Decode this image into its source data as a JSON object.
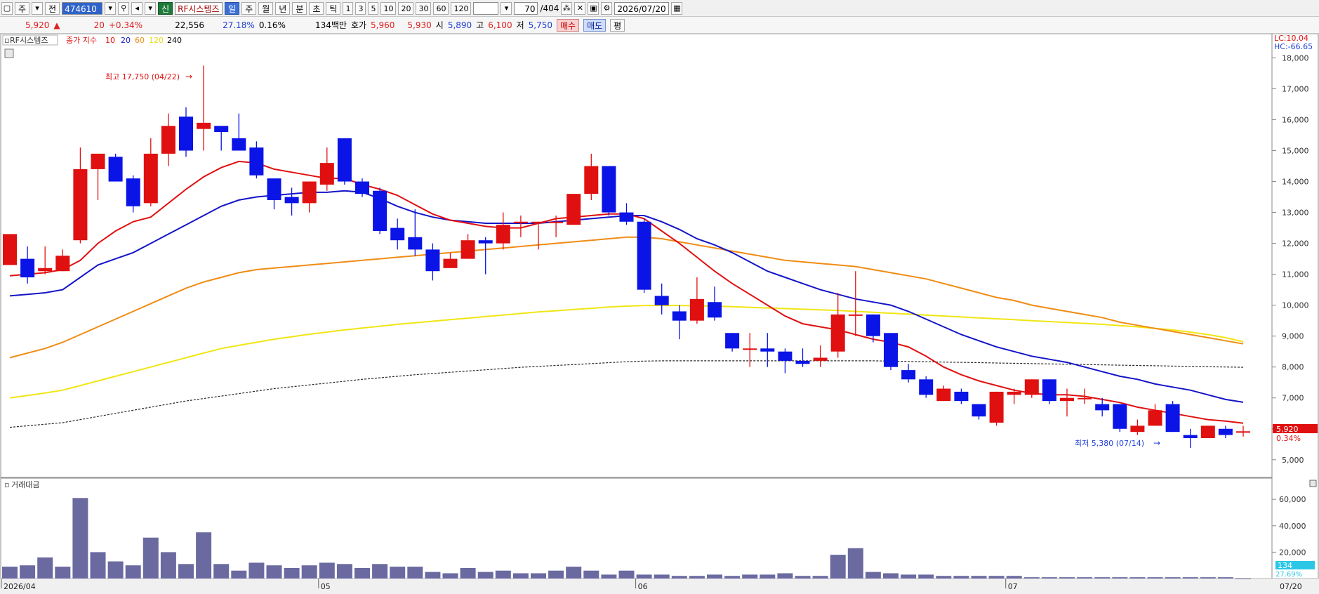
{
  "toolbar": {
    "period_main": "주",
    "type_label": "전",
    "code": "474610",
    "name_badge": "신",
    "name": "RF시스템즈",
    "periods": [
      "일",
      "주",
      "월",
      "년",
      "분",
      "초",
      "틱"
    ],
    "selected_period": "일",
    "intervals": [
      "1",
      "3",
      "5",
      "10",
      "20",
      "30",
      "60",
      "120"
    ],
    "count": "70",
    "total": "/404",
    "date": "2026/07/20"
  },
  "quote": {
    "price": "5,920",
    "arrow": "▲",
    "change": "20",
    "change_pct": "+0.34%",
    "volume": "22,556",
    "turnover_pct": "27.18%",
    "ratio": "0.16%",
    "amount": "134백만",
    "hoga_label": "호가",
    "ask": "5,960",
    "bid": "5,930",
    "open_label": "시",
    "open": "5,890",
    "high_label": "고",
    "high": "6,100",
    "low_label": "저",
    "low": "5,750",
    "buy_label": "매수",
    "sell_label": "매도",
    "eval_label": "평"
  },
  "legend": {
    "name": "RF시스템즈",
    "ma_title": "종가 지수",
    "ma_periods": [
      "10",
      "20",
      "60",
      "120",
      "240"
    ]
  },
  "price_panel": {
    "lc_label": "LC:10.04",
    "hc_label": "HC:-66.65",
    "y_ticks": [
      "18,000",
      "17,000",
      "16,000",
      "15,000",
      "14,000",
      "13,000",
      "12,000",
      "11,000",
      "10,000",
      "9,000",
      "8,000",
      "7,000",
      "6,000",
      "5,000"
    ],
    "high_annot": "최고 17,750 (04/22)",
    "low_annot": "최저 5,380 (07/14)",
    "last_price_tag": "5,920",
    "last_pct_tag": "0.34%"
  },
  "volume_panel": {
    "title": "거래대금",
    "y_ticks": [
      "60,000",
      "40,000",
      "20,000"
    ],
    "last_tag": "134",
    "pct_tag": "27.69%"
  },
  "x_ticks": [
    "2026/04",
    "05",
    "06",
    "07",
    "07/20"
  ],
  "colors": {
    "up": "#e01010",
    "down": "#0a14e6",
    "ma10": "#e01010",
    "ma20": "#1414c8",
    "ma60": "#f08c14",
    "ma120": "#f0e614",
    "ma240": "#282828",
    "volume": "#6a6aa0"
  },
  "chart_data": {
    "type": "candlestick",
    "ylim": [
      4700,
      18600
    ],
    "x_tick_indices": {
      "2026/04": 0,
      "05": 18,
      "06": 36,
      "07": 57
    },
    "candles": [
      {
        "o": 11300,
        "h": 12300,
        "l": 11300,
        "c": 12300
      },
      {
        "o": 11500,
        "h": 11900,
        "l": 10700,
        "c": 10900
      },
      {
        "o": 11100,
        "h": 11900,
        "l": 11000,
        "c": 11200
      },
      {
        "o": 11100,
        "h": 11800,
        "l": 11100,
        "c": 11600
      },
      {
        "o": 12100,
        "h": 15100,
        "l": 12000,
        "c": 14400
      },
      {
        "o": 14400,
        "h": 14900,
        "l": 13400,
        "c": 14900
      },
      {
        "o": 14800,
        "h": 14900,
        "l": 14000,
        "c": 14000
      },
      {
        "o": 14100,
        "h": 14200,
        "l": 13000,
        "c": 13200
      },
      {
        "o": 13300,
        "h": 15400,
        "l": 13200,
        "c": 14900
      },
      {
        "o": 14900,
        "h": 16200,
        "l": 14500,
        "c": 15800
      },
      {
        "o": 16100,
        "h": 16400,
        "l": 14800,
        "c": 15000
      },
      {
        "o": 15700,
        "h": 17750,
        "l": 15000,
        "c": 15900
      },
      {
        "o": 15800,
        "h": 15800,
        "l": 15000,
        "c": 15600
      },
      {
        "o": 15400,
        "h": 16200,
        "l": 15000,
        "c": 15000
      },
      {
        "o": 15100,
        "h": 15300,
        "l": 14100,
        "c": 14200
      },
      {
        "o": 14100,
        "h": 14100,
        "l": 13100,
        "c": 13400
      },
      {
        "o": 13500,
        "h": 13800,
        "l": 12900,
        "c": 13300
      },
      {
        "o": 13300,
        "h": 13900,
        "l": 13000,
        "c": 14000
      },
      {
        "o": 13900,
        "h": 15100,
        "l": 13700,
        "c": 14600
      },
      {
        "o": 15400,
        "h": 15400,
        "l": 13900,
        "c": 14000
      },
      {
        "o": 14000,
        "h": 14100,
        "l": 13500,
        "c": 13600
      },
      {
        "o": 13700,
        "h": 13800,
        "l": 12300,
        "c": 12400
      },
      {
        "o": 12500,
        "h": 12800,
        "l": 11800,
        "c": 12100
      },
      {
        "o": 12200,
        "h": 13100,
        "l": 11600,
        "c": 11800
      },
      {
        "o": 11800,
        "h": 12000,
        "l": 10800,
        "c": 11100
      },
      {
        "o": 11200,
        "h": 11700,
        "l": 11200,
        "c": 11500
      },
      {
        "o": 11500,
        "h": 12300,
        "l": 11500,
        "c": 12100
      },
      {
        "o": 12100,
        "h": 12200,
        "l": 11000,
        "c": 12000
      },
      {
        "o": 12000,
        "h": 13000,
        "l": 11800,
        "c": 12600
      },
      {
        "o": 12700,
        "h": 12900,
        "l": 12200,
        "c": 12700
      },
      {
        "o": 12700,
        "h": 12700,
        "l": 11800,
        "c": 12700
      },
      {
        "o": 12700,
        "h": 12900,
        "l": 12200,
        "c": 12700
      },
      {
        "o": 12600,
        "h": 13600,
        "l": 12600,
        "c": 13600
      },
      {
        "o": 13600,
        "h": 14900,
        "l": 13400,
        "c": 14500
      },
      {
        "o": 14500,
        "h": 14500,
        "l": 12900,
        "c": 13000
      },
      {
        "o": 13000,
        "h": 13300,
        "l": 12600,
        "c": 12700
      },
      {
        "o": 12700,
        "h": 12800,
        "l": 10400,
        "c": 10500
      },
      {
        "o": 10300,
        "h": 10700,
        "l": 9700,
        "c": 10000
      },
      {
        "o": 9800,
        "h": 10000,
        "l": 8900,
        "c": 9500
      },
      {
        "o": 9500,
        "h": 10900,
        "l": 9400,
        "c": 10200
      },
      {
        "o": 10100,
        "h": 10600,
        "l": 9500,
        "c": 9600
      },
      {
        "o": 9100,
        "h": 9100,
        "l": 8500,
        "c": 8600
      },
      {
        "o": 8600,
        "h": 9100,
        "l": 8000,
        "c": 8600
      },
      {
        "o": 8600,
        "h": 9100,
        "l": 8000,
        "c": 8500
      },
      {
        "o": 8500,
        "h": 8600,
        "l": 7800,
        "c": 8200
      },
      {
        "o": 8200,
        "h": 8600,
        "l": 8000,
        "c": 8100
      },
      {
        "o": 8200,
        "h": 8700,
        "l": 8000,
        "c": 8300
      },
      {
        "o": 8500,
        "h": 10400,
        "l": 8300,
        "c": 9700
      },
      {
        "o": 9700,
        "h": 11100,
        "l": 9000,
        "c": 9700
      },
      {
        "o": 9700,
        "h": 9700,
        "l": 8800,
        "c": 9000
      },
      {
        "o": 9100,
        "h": 9100,
        "l": 7900,
        "c": 8000
      },
      {
        "o": 7900,
        "h": 8100,
        "l": 7500,
        "c": 7600
      },
      {
        "o": 7600,
        "h": 7700,
        "l": 7000,
        "c": 7100
      },
      {
        "o": 6900,
        "h": 7400,
        "l": 6900,
        "c": 7300
      },
      {
        "o": 7200,
        "h": 7300,
        "l": 6800,
        "c": 6900
      },
      {
        "o": 6800,
        "h": 6800,
        "l": 6300,
        "c": 6400
      },
      {
        "o": 6200,
        "h": 7200,
        "l": 6100,
        "c": 7200
      },
      {
        "o": 7100,
        "h": 7300,
        "l": 6800,
        "c": 7200
      },
      {
        "o": 7100,
        "h": 7600,
        "l": 7000,
        "c": 7600
      },
      {
        "o": 7600,
        "h": 7600,
        "l": 6800,
        "c": 6900
      },
      {
        "o": 6900,
        "h": 7300,
        "l": 6400,
        "c": 7000
      },
      {
        "o": 7000,
        "h": 7300,
        "l": 6800,
        "c": 7000
      },
      {
        "o": 6800,
        "h": 7000,
        "l": 6400,
        "c": 6600
      },
      {
        "o": 6800,
        "h": 6800,
        "l": 5900,
        "c": 6000
      },
      {
        "o": 5900,
        "h": 6300,
        "l": 5800,
        "c": 6100
      },
      {
        "o": 6100,
        "h": 6800,
        "l": 6100,
        "c": 6600
      },
      {
        "o": 6800,
        "h": 6900,
        "l": 5900,
        "c": 5900
      },
      {
        "o": 5800,
        "h": 6000,
        "l": 5380,
        "c": 5700
      },
      {
        "o": 5700,
        "h": 6100,
        "l": 5700,
        "c": 6100
      },
      {
        "o": 6000,
        "h": 6100,
        "l": 5700,
        "c": 5800
      },
      {
        "o": 5890,
        "h": 6100,
        "l": 5750,
        "c": 5920
      }
    ],
    "ma10": [
      10950,
      11000,
      11050,
      11150,
      11450,
      12000,
      12400,
      12700,
      12850,
      13300,
      13750,
      14150,
      14450,
      14650,
      14600,
      14400,
      14300,
      14200,
      14100,
      14100,
      13900,
      13750,
      13550,
      13250,
      12950,
      12750,
      12650,
      12550,
      12500,
      12500,
      12650,
      12800,
      12850,
      12900,
      12950,
      12950,
      12800,
      12400,
      12000,
      11550,
      11100,
      10700,
      10350,
      10000,
      9650,
      9400,
      9300,
      9200,
      9050,
      8900,
      8800,
      8650,
      8350,
      8000,
      7750,
      7550,
      7400,
      7250,
      7150,
      7100,
      7100,
      7050,
      6950,
      6850,
      6700,
      6600,
      6500,
      6400,
      6300,
      6250,
      6180
    ],
    "ma20": [
      10300,
      10350,
      10400,
      10500,
      10900,
      11300,
      11500,
      11700,
      12000,
      12300,
      12600,
      12900,
      13200,
      13400,
      13500,
      13550,
      13600,
      13650,
      13650,
      13700,
      13650,
      13450,
      13200,
      13000,
      12850,
      12750,
      12700,
      12650,
      12650,
      12650,
      12650,
      12700,
      12750,
      12800,
      12850,
      12900,
      12900,
      12700,
      12450,
      12150,
      11950,
      11700,
      11400,
      11100,
      10900,
      10700,
      10500,
      10350,
      10200,
      10100,
      10000,
      9800,
      9550,
      9300,
      9050,
      8850,
      8650,
      8500,
      8350,
      8250,
      8150,
      8000,
      7850,
      7700,
      7600,
      7450,
      7350,
      7250,
      7100,
      6950,
      6860
    ],
    "ma60": [
      8300,
      8450,
      8600,
      8800,
      9050,
      9300,
      9550,
      9800,
      10050,
      10300,
      10550,
      10750,
      10900,
      11050,
      11150,
      11200,
      11250,
      11300,
      11350,
      11400,
      11450,
      11500,
      11550,
      11600,
      11650,
      11700,
      11750,
      11800,
      11850,
      11900,
      11950,
      12000,
      12050,
      12100,
      12150,
      12200,
      12200,
      12150,
      12050,
      11950,
      11850,
      11750,
      11650,
      11550,
      11450,
      11400,
      11350,
      11300,
      11250,
      11150,
      11050,
      10950,
      10850,
      10700,
      10550,
      10400,
      10250,
      10150,
      10000,
      9900,
      9800,
      9700,
      9600,
      9450,
      9350,
      9250,
      9150,
      9050,
      8950,
      8850,
      8750
    ],
    "ma120": [
      7000,
      7080,
      7160,
      7250,
      7400,
      7550,
      7700,
      7850,
      8000,
      8150,
      8300,
      8450,
      8600,
      8700,
      8800,
      8900,
      8980,
      9060,
      9130,
      9200,
      9260,
      9320,
      9380,
      9430,
      9480,
      9530,
      9580,
      9630,
      9680,
      9730,
      9780,
      9820,
      9860,
      9900,
      9940,
      9970,
      9990,
      9990,
      9990,
      9980,
      9970,
      9950,
      9930,
      9910,
      9890,
      9870,
      9850,
      9830,
      9800,
      9770,
      9740,
      9710,
      9680,
      9650,
      9620,
      9590,
      9560,
      9530,
      9500,
      9470,
      9440,
      9410,
      9380,
      9340,
      9300,
      9250,
      9200,
      9130,
      9050,
      8950,
      8820
    ],
    "ma240": [
      6050,
      6100,
      6150,
      6200,
      6300,
      6400,
      6500,
      6600,
      6700,
      6800,
      6900,
      6980,
      7060,
      7140,
      7220,
      7300,
      7360,
      7420,
      7480,
      7540,
      7600,
      7650,
      7700,
      7750,
      7790,
      7830,
      7870,
      7910,
      7950,
      7990,
      8020,
      8050,
      8080,
      8110,
      8140,
      8170,
      8190,
      8200,
      8200,
      8200,
      8200,
      8200,
      8200,
      8200,
      8200,
      8200,
      8200,
      8200,
      8200,
      8200,
      8190,
      8180,
      8170,
      8160,
      8150,
      8140,
      8130,
      8120,
      8110,
      8100,
      8090,
      8080,
      8070,
      8060,
      8050,
      8040,
      8030,
      8020,
      8010,
      8000,
      7990
    ],
    "volume_ylim": [
      0,
      67000
    ],
    "volume": [
      9000,
      10000,
      16000,
      9000,
      61000,
      20000,
      13000,
      10000,
      31000,
      20000,
      11000,
      35000,
      11000,
      6000,
      12000,
      10000,
      8000,
      10000,
      12000,
      11000,
      8000,
      11000,
      9000,
      9000,
      5000,
      4000,
      8000,
      5000,
      6000,
      4000,
      4000,
      6000,
      9000,
      6000,
      3000,
      6000,
      3000,
      3000,
      2000,
      2000,
      3000,
      2000,
      3000,
      3000,
      4000,
      2000,
      2000,
      18000,
      23000,
      5000,
      4000,
      3000,
      3000,
      2000,
      2000,
      2000,
      2000,
      2000,
      1000,
      1000,
      1000,
      1000,
      1000,
      1000,
      1000,
      1000,
      1000,
      1000,
      1000,
      1000,
      134
    ]
  }
}
